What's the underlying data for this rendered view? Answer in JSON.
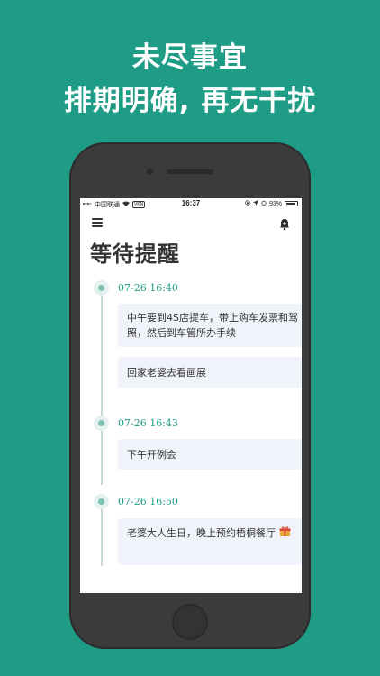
{
  "promo": {
    "line1": "未尽事宜",
    "line2": "排期明确, 再无干扰"
  },
  "statusbar": {
    "carrier": "中国联通",
    "vpn": "VPN",
    "time": "16:37",
    "battery": "93%",
    "battery_level": 0.93
  },
  "app": {
    "title": "等待提醒"
  },
  "groups": [
    {
      "time": "07-26 16:40",
      "items": [
        "中午要到4S店提车，带上购车发票和驾照，然后到车管所办手续",
        "回家老婆去看画展"
      ]
    },
    {
      "time": "07-26 16:43",
      "items": [
        "下午开例会"
      ]
    },
    {
      "time": "07-26 16:50",
      "items": [
        "老婆大人生日，晚上预约梧桐餐厅"
      ]
    }
  ],
  "colors": {
    "brand": "#1e9c86",
    "card_bg": "#f0f3f9"
  }
}
